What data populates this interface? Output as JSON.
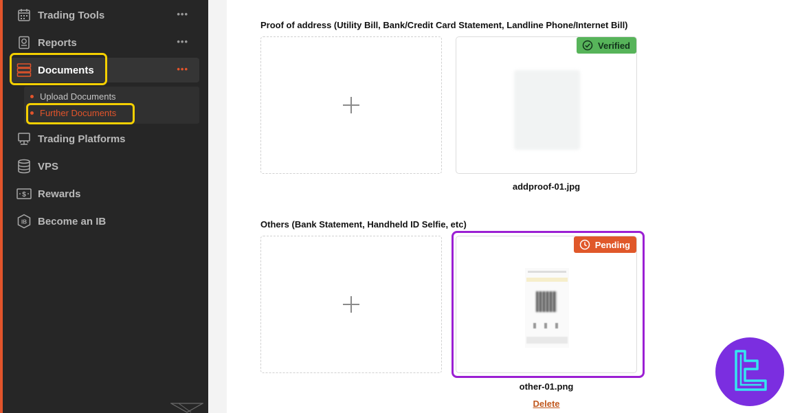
{
  "sidebar": {
    "items": [
      {
        "label": "Trading Tools",
        "icon": "calendar-grid-icon",
        "has_menu": true
      },
      {
        "label": "Reports",
        "icon": "report-document-icon",
        "has_menu": true
      },
      {
        "label": "Documents",
        "icon": "documents-stack-icon",
        "has_menu": true,
        "active": true
      },
      {
        "label": "Trading Platforms",
        "icon": "platform-monitor-icon",
        "has_menu": false
      },
      {
        "label": "VPS",
        "icon": "server-stack-icon",
        "has_menu": false
      },
      {
        "label": "Rewards",
        "icon": "dollar-bill-icon",
        "has_menu": false
      },
      {
        "label": "Become an IB",
        "icon": "ib-shield-icon",
        "has_menu": false
      }
    ],
    "menu_glyph": "•••",
    "submenu": [
      {
        "label": "Upload Documents",
        "active": false
      },
      {
        "label": "Further Documents",
        "active": true
      }
    ]
  },
  "sections": {
    "proof_of_address": {
      "title": "Proof of address (Utility Bill, Bank/Credit Card Statement, Landline Phone/Internet Bill)",
      "file_name": "addproof-01.jpg",
      "status": "Verified"
    },
    "others": {
      "title": "Others (Bank Statement, Handheld ID Selfie, etc)",
      "file_name": "other-01.png",
      "status": "Pending",
      "delete_label": "Delete"
    }
  },
  "colors": {
    "accent": "#e2542b",
    "highlight_yellow": "#f5d000",
    "highlight_purple": "#9b1fd3",
    "verified": "#57b45a",
    "pending": "#e0582a",
    "brand_badge": "#7b2ee0",
    "brand_mark": "#35e6ef"
  }
}
